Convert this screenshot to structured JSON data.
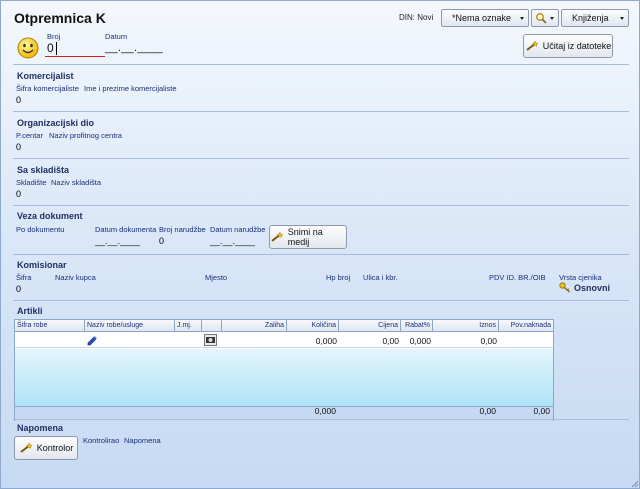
{
  "title": "Otpremnica K",
  "top": {
    "din_label": "DIN: Novi",
    "nema_oznake": "*Nema oznake",
    "knjizenja": "Knjiženja"
  },
  "header": {
    "broj_label": "Broj",
    "broj_value": "0",
    "datum_label": "Datum",
    "datum_value": "__.__.____",
    "ucitaj_label": "Učitaj iz datoteke"
  },
  "komercijalist": {
    "title": "Komercijalist",
    "sifra_label": "Šifra komercijaliste",
    "ime_label": "Ime i prezime komercijaliste",
    "value": "0"
  },
  "org": {
    "title": "Organizacijski dio",
    "pcentar_label": "P.centar",
    "naziv_label": "Naziv profitnog centra",
    "value": "0"
  },
  "skladista": {
    "title": "Sa skladišta",
    "skladiste_label": "Skladište",
    "naziv_label": "Naziv skladišta",
    "value": "0"
  },
  "veza": {
    "title": "Veza dokument",
    "po_dokumentu_label": "Po dokumentu",
    "datum_dokumenta_label": "Datum dokumenta",
    "datum_dokumenta_value": "__.__.____",
    "broj_narudzbe_label": "Broj narudžbe",
    "broj_narudzbe_value": "0",
    "datum_narudzbe_label": "Datum narudžbe",
    "datum_narudzbe_value": "__.__.____",
    "snimi_label": "Snimi na medij"
  },
  "komisionar": {
    "title": "Komisionar",
    "sifra_label": "Šifra",
    "sifra_value": "0",
    "naziv_kupca_label": "Naziv kupca",
    "mjesto_label": "Mjesto",
    "hp_broj_label": "Hp broj",
    "ulica_label": "Ulica i kbr.",
    "pdv_label": "PDV ID. BR./OIB",
    "vrsta_cjenika_label": "Vrsta cjenika",
    "vrsta_cjenika_value": "Osnovni"
  },
  "artikli": {
    "title": "Artikli",
    "columns": [
      "Šifra robe",
      "Naziv robe/usluge",
      "J.mj.",
      "",
      "Zaliha",
      "Količina",
      "Cijena",
      "Rabat%",
      "Iznos",
      "Pov.naknada"
    ],
    "row": {
      "kolicina": "0,000",
      "cijena": "0,00",
      "rabat": "0,000",
      "iznos": "0,00"
    },
    "totals": {
      "kolicina": "0,000",
      "iznos": "0,00",
      "pov_naknada": "0,00"
    }
  },
  "napomena": {
    "title": "Napomena",
    "kontrolor_label": "Kontrolor",
    "kontrolirao_label": "Kontrolirao",
    "napomena_label": "Napomena"
  }
}
